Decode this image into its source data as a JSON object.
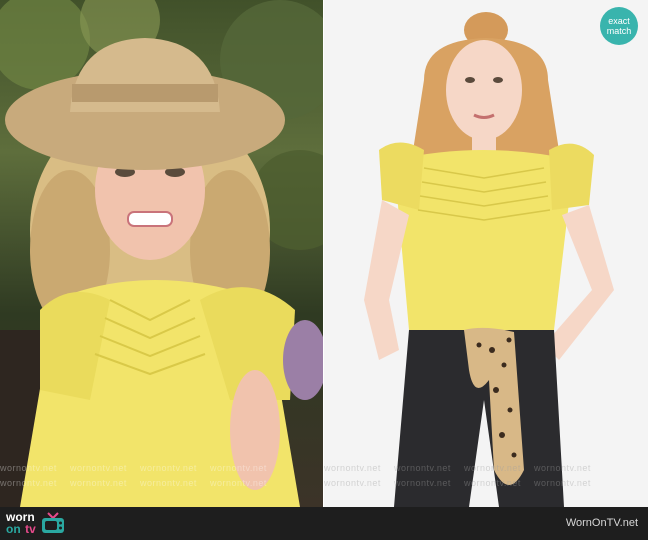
{
  "badge": {
    "line1": "exact",
    "line2": "match"
  },
  "watermark": {
    "text": "wornontv.net"
  },
  "footer": {
    "logo_worn": "worn",
    "logo_on": "on",
    "logo_tv": "tv",
    "site_url": "WornOnTV.net"
  },
  "colors": {
    "badge": "#39b4ad",
    "footer_bg": "#1e1e1e",
    "top_yellow": "#f2e46a",
    "jeans": "#2b2b2e"
  }
}
